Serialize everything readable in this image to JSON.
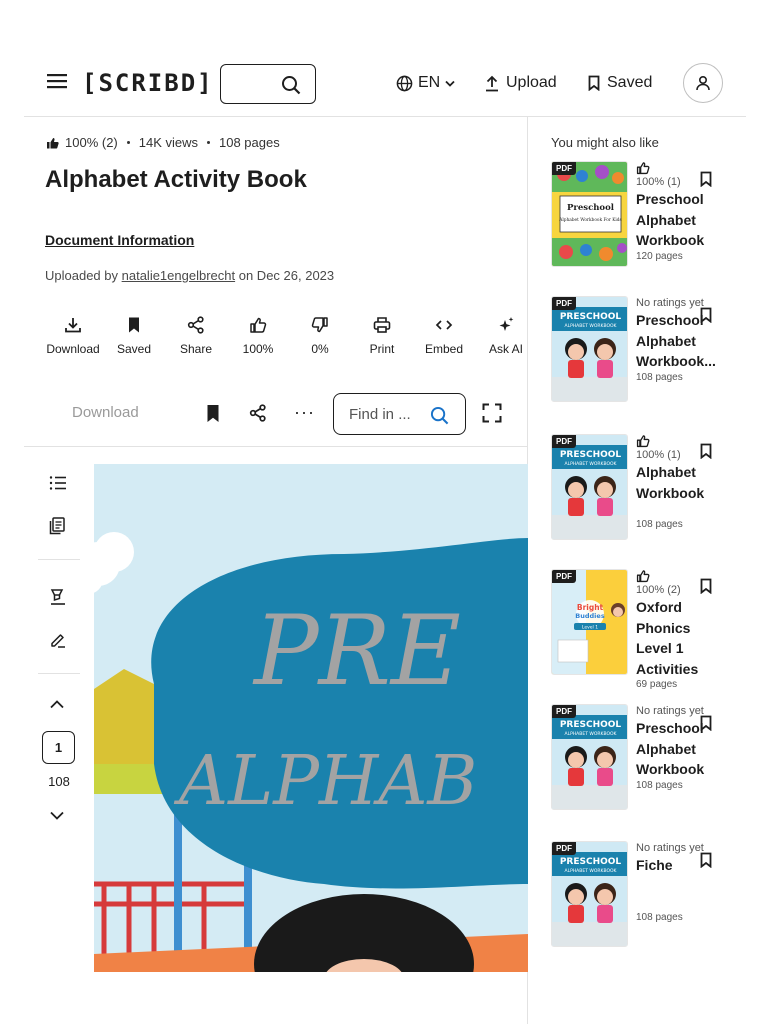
{
  "header": {
    "logo": "[SCRIBD]",
    "language": "EN",
    "upload_label": "Upload",
    "saved_label": "Saved"
  },
  "document": {
    "rating": "100% (2)",
    "views": "14K views",
    "pages": "108 pages",
    "title": "Alphabet Activity Book",
    "info_link": "Document Information",
    "uploaded_prefix": "Uploaded by",
    "uploader": "natalie1engelbrecht",
    "uploaded_suffix": "on Dec 26, 2023"
  },
  "actions": [
    {
      "label": "Download",
      "icon": "download-icon"
    },
    {
      "label": "Saved",
      "icon": "bookmark-filled-icon"
    },
    {
      "label": "Share",
      "icon": "share-icon"
    },
    {
      "label": "100%",
      "icon": "thumbs-up-icon"
    },
    {
      "label": "0%",
      "icon": "thumbs-down-icon"
    },
    {
      "label": "Print",
      "icon": "print-icon"
    },
    {
      "label": "Embed",
      "icon": "embed-icon"
    },
    {
      "label": "Ask AI",
      "icon": "sparkle-icon"
    }
  ],
  "toolbar": {
    "download_label": "Download",
    "find_placeholder": "Find in ...",
    "more_label": "···"
  },
  "viewer": {
    "current_page": "1",
    "total_pages": "108",
    "cover_text_1": "PRE",
    "cover_text_2": "ALPHAB"
  },
  "sidebar": {
    "heading": "You might also like",
    "badge": "PDF",
    "items": [
      {
        "rating": "100% (1)",
        "title": "Preschool Alphabet Workbook",
        "pages": "120 pages",
        "cover": "colorful"
      },
      {
        "rating": "No ratings yet",
        "title": "Preschool Alphabet Workbook...",
        "pages": "108 pages",
        "cover": "kids"
      },
      {
        "rating": "100% (1)",
        "title": "Alphabet Workbook",
        "pages": "108 pages",
        "cover": "kids"
      },
      {
        "rating": "100% (2)",
        "title": "Oxford Phonics Level 1 Activities",
        "pages": "69 pages",
        "cover": "yellow"
      },
      {
        "rating": "No ratings yet",
        "title": "Preschool Alphabet Workbook",
        "pages": "108 pages",
        "cover": "kids"
      },
      {
        "rating": "No ratings yet",
        "title": "Fiche",
        "pages": "108 pages",
        "cover": "kids"
      }
    ],
    "thumb_cover_labels": {
      "preschool": "Preschool",
      "sub": "Alphabet Workbook For Kids",
      "kids_title": "PRESCHOOL",
      "kids_sub": "ALPHABET WORKBOOK",
      "oxford_1": "Bright",
      "oxford_2": "Buddies",
      "oxford_level": "Level 1"
    }
  }
}
